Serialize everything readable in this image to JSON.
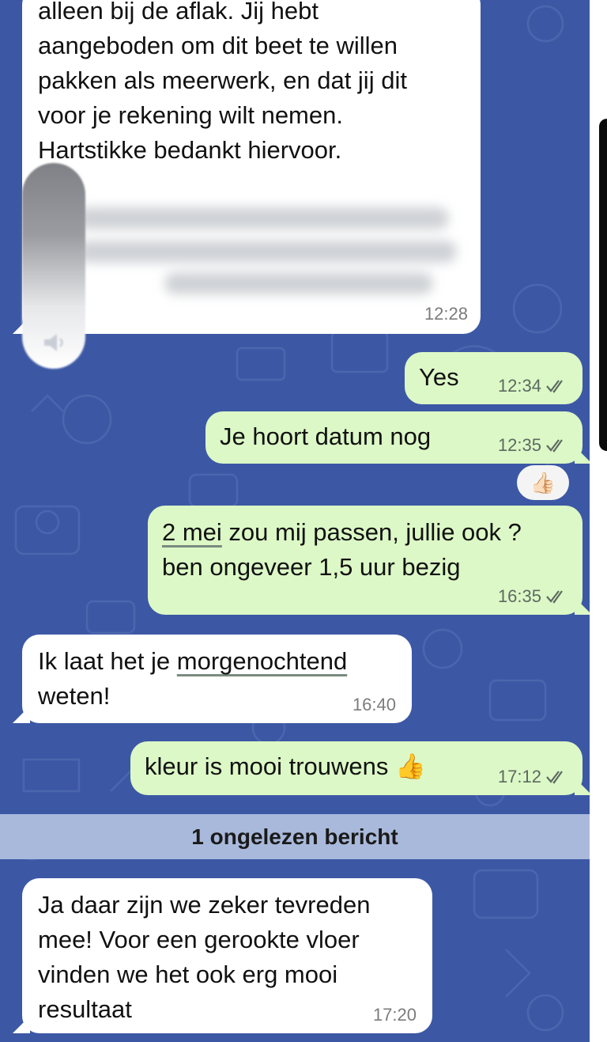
{
  "messages": [
    {
      "id": "m1",
      "dir": "in",
      "text": "alleen bij de aflak. Jij hebt\naangeboden om dit beet te willen\npakken als meerwerk, en dat jij dit\nvoor je rekening wilt nemen.\nHartstikke bedankt hiervoor.",
      "time": "12:28"
    },
    {
      "id": "m2",
      "dir": "out",
      "text": "Yes",
      "time": "12:34",
      "read": true
    },
    {
      "id": "m3",
      "dir": "out",
      "text": "Je hoort datum nog",
      "time": "12:35",
      "read": true,
      "reaction": "👍🏻"
    },
    {
      "id": "m4",
      "dir": "out",
      "text_prefix_linked": "2 mei",
      "text_after_link": " zou mij passen, jullie ook ?",
      "text_line2": "ben ongeveer 1,5 uur bezig",
      "time": "16:35",
      "read": true
    },
    {
      "id": "m5",
      "dir": "in",
      "text_before_link": "Ik laat het je ",
      "text_linked": "morgenochtend",
      "text_line2": "weten!",
      "time": "16:40"
    },
    {
      "id": "m6",
      "dir": "out",
      "text": "kleur is mooi trouwens 👍",
      "time": "17:12",
      "read": true
    },
    {
      "id": "m7",
      "dir": "in",
      "text": "Ja daar zijn we zeker tevreden\nmee! Voor een gerookte vloer\nvinden we het ook erg mooi\nresultaat",
      "time": "17:20"
    }
  ],
  "unread_divider": "1 ongelezen bericht",
  "colors": {
    "chat_background": "#3c58a5",
    "outgoing_bubble": "#dcf8c6",
    "incoming_bubble": "#ffffff",
    "unread_bar": "#a9b9db"
  },
  "icons": [
    "double-check-icon",
    "speaker-icon"
  ]
}
